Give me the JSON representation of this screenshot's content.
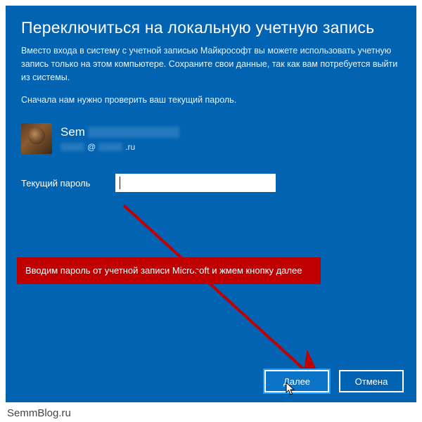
{
  "title": "Переключиться на локальную учетную запись",
  "description1": "Вместо входа в систему с учетной записью Майкрософт вы можете использовать учетную запись только на этом компьютере. Сохраните свои данные, так как вам потребуется выйти из системы.",
  "description2": "Сначала нам нужно проверить ваш текущий пароль.",
  "user": {
    "name_visible_prefix": "Sem",
    "email_at": "@",
    "email_domain_suffix": ".ru"
  },
  "password": {
    "label": "Текущий пароль",
    "value": ""
  },
  "annotation": {
    "text": "Вводим пароль от учетной записи Microsoft и жмем кнопку далее"
  },
  "buttons": {
    "next": "Далее",
    "cancel": "Отмена"
  },
  "branding": "SemmBlog.ru",
  "colors": {
    "panel_bg": "#0263b2",
    "annotation_bg": "#c00000",
    "button_focus": "#1a9bff"
  }
}
